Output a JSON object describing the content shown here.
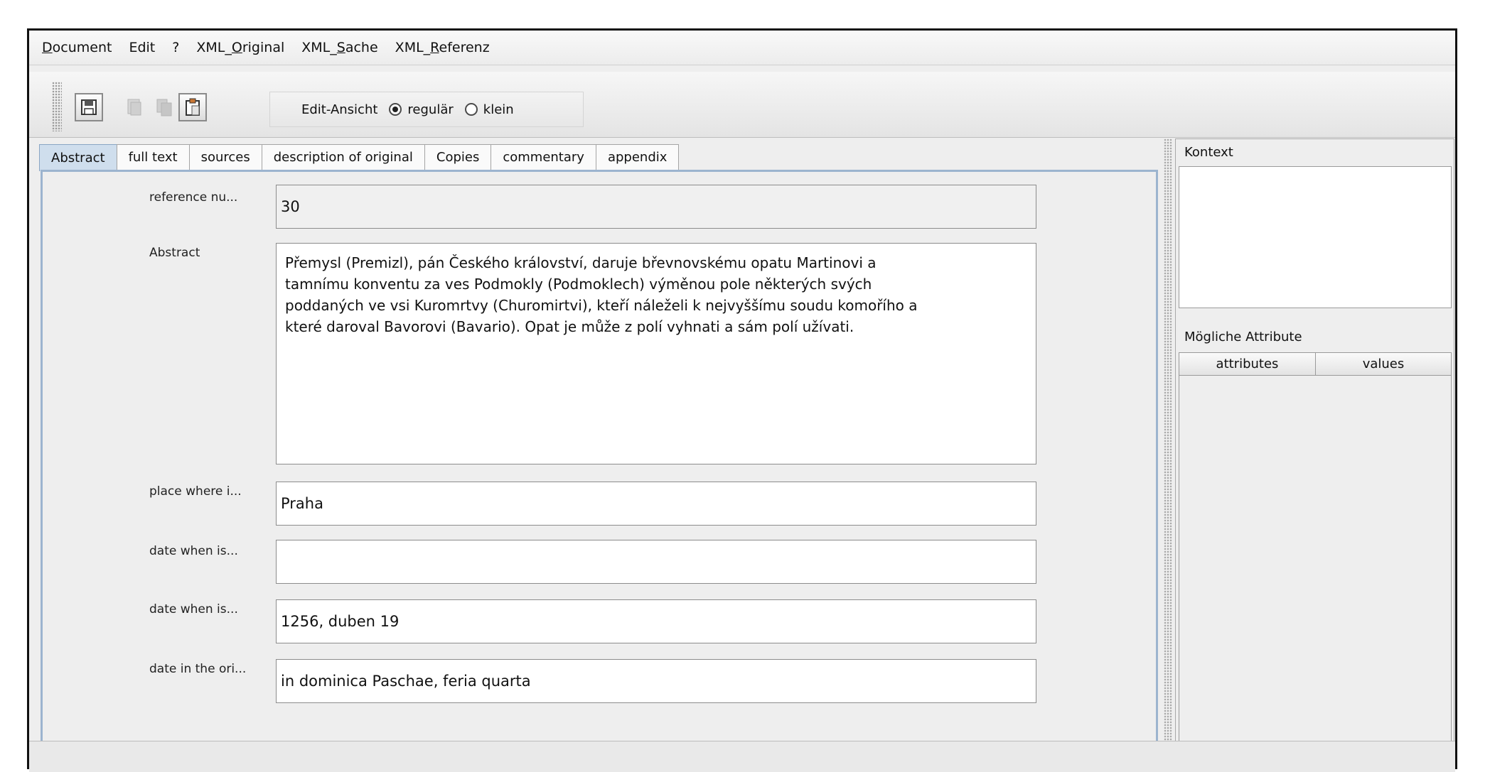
{
  "menu": [
    "Document",
    "Edit",
    "?",
    "XML_Original",
    "XML_Sache",
    "XML_Referenz"
  ],
  "toolbar": {
    "edit_view_label": "Edit-Ansicht",
    "radio_regular": "regulär",
    "radio_small": "klein",
    "selected": "regulär"
  },
  "tabs": [
    "Abstract",
    "full text",
    "sources",
    "description of original",
    "Copies",
    "commentary",
    "appendix"
  ],
  "active_tab": "Abstract",
  "form": {
    "reference": {
      "label": "reference nu...",
      "value": "30"
    },
    "abstract": {
      "label": "Abstract",
      "lines": [
        "Přemysl (Premizl), pán Českého království, daruje břevnovskému opatu Martinovi a",
        "tamnímu konventu za ves Podmokly (Podmoklech)  výměnou pole některých svých",
        "poddaných ve vsi Kuromrtvy (Churomirtvi), kteří náleželi k nejvyššímu soudu komořího a",
        "které daroval Bavorovi (Bavario). Opat je může z polí vyhnati a sám polí užívati."
      ]
    },
    "place": {
      "label": "place where i...",
      "value": "Praha"
    },
    "date1": {
      "label": "date when is...",
      "value": ""
    },
    "date2": {
      "label": "date when is...",
      "value": "1256, duben 19"
    },
    "date_orig": {
      "label": "date in the ori...",
      "value": "in dominica Paschae, feria quarta"
    }
  },
  "sidebar": {
    "kontext_title": "Kontext",
    "attributes_title": "Mögliche Attribute",
    "columns": [
      "attributes",
      "values"
    ]
  }
}
